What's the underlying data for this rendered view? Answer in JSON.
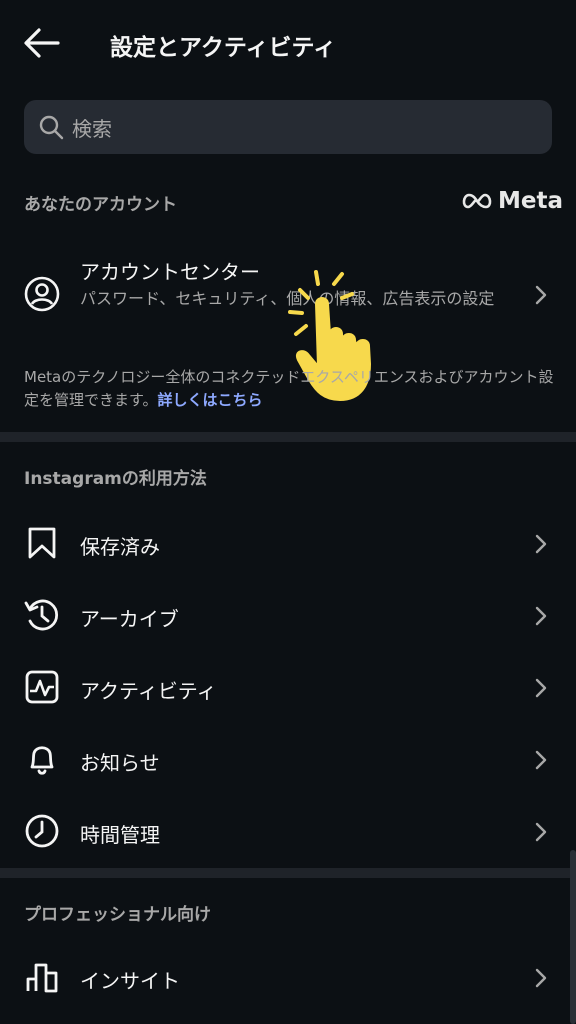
{
  "header": {
    "title": "設定とアクティビティ"
  },
  "search": {
    "placeholder": "検索"
  },
  "sections": {
    "account": "あなたのアカウント",
    "usage": "Instagramの利用方法",
    "pro": "プロフェッショナル向け"
  },
  "meta_logo_text": "Meta",
  "account_center": {
    "title": "アカウントセンター",
    "subtitle": "パスワード、セキュリティ、個人の情報、広告表示の設定"
  },
  "note": {
    "text": "Metaのテクノロジー全体のコネクテッドエクスペリエンスおよびアカウント設定を管理できます。",
    "link": "詳しくはこちら"
  },
  "usage_items": [
    {
      "label": "保存済み",
      "icon": "bookmark-icon"
    },
    {
      "label": "アーカイブ",
      "icon": "archive-icon"
    },
    {
      "label": "アクティビティ",
      "icon": "activity-icon"
    },
    {
      "label": "お知らせ",
      "icon": "bell-icon"
    },
    {
      "label": "時間管理",
      "icon": "clock-icon"
    }
  ],
  "pro_items": [
    {
      "label": "インサイト",
      "icon": "bar-chart-icon"
    }
  ],
  "colors": {
    "background": "#0c1014",
    "link": "#8ea9ff",
    "hand": "#f7d94c"
  }
}
